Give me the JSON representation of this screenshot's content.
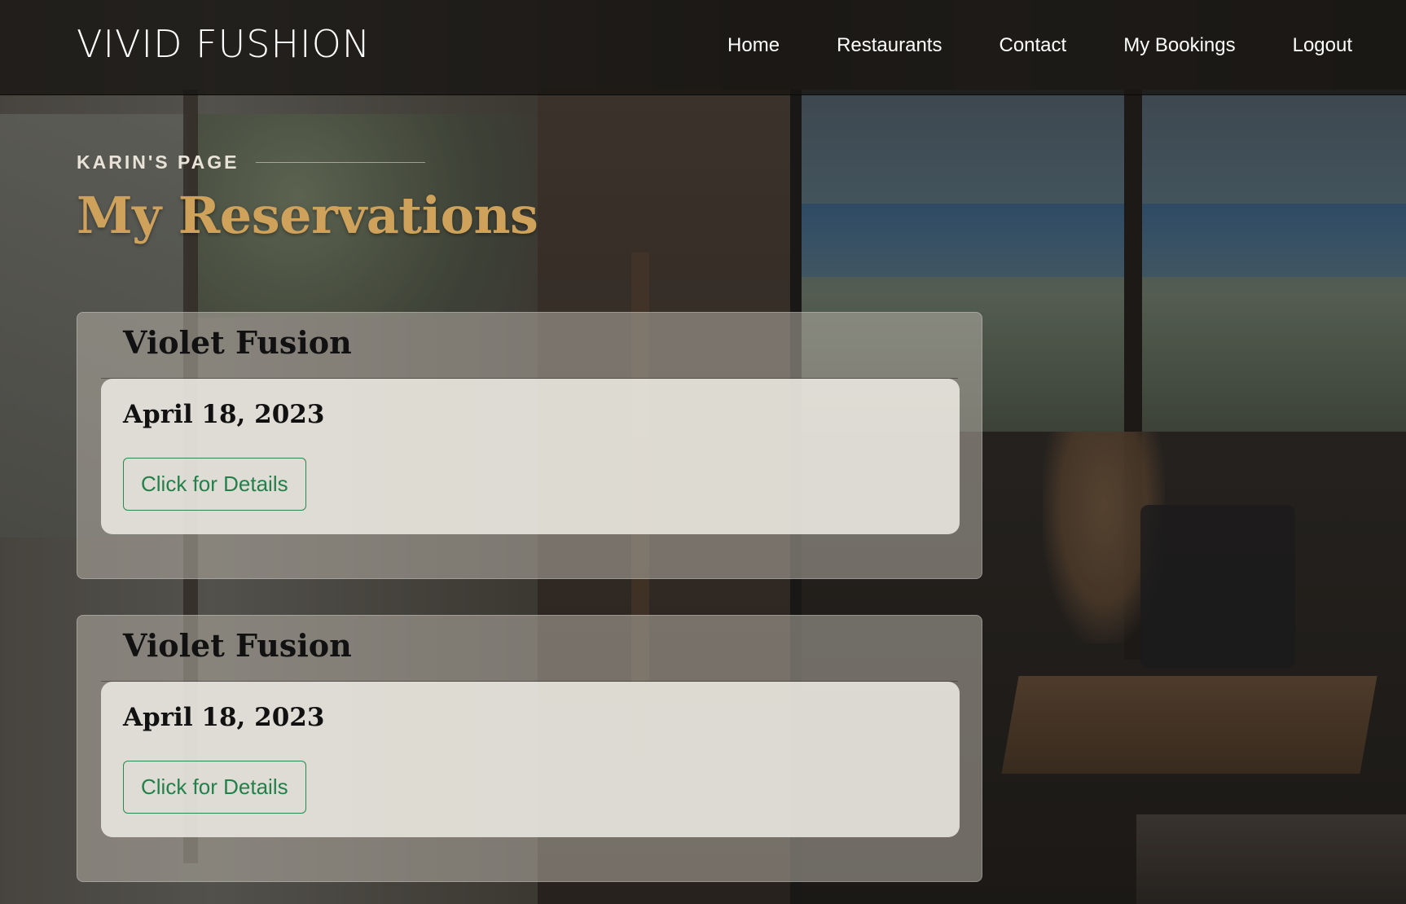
{
  "header": {
    "brand": "VIVID FUSHION",
    "nav": [
      {
        "label": "Home"
      },
      {
        "label": "Restaurants"
      },
      {
        "label": "Contact"
      },
      {
        "label": "My Bookings"
      },
      {
        "label": "Logout"
      }
    ]
  },
  "main": {
    "eyebrow": "KARIN'S PAGE",
    "title": "My Reservations",
    "reservations": [
      {
        "restaurant": "Violet Fusion",
        "date": "April 18, 2023",
        "button_label": "Click for Details"
      },
      {
        "restaurant": "Violet Fusion",
        "date": "April 18, 2023",
        "button_label": "Click for Details"
      }
    ]
  },
  "colors": {
    "title_gold": "#cfa25c",
    "button_green": "#23804a",
    "header_bg": "#181614"
  }
}
